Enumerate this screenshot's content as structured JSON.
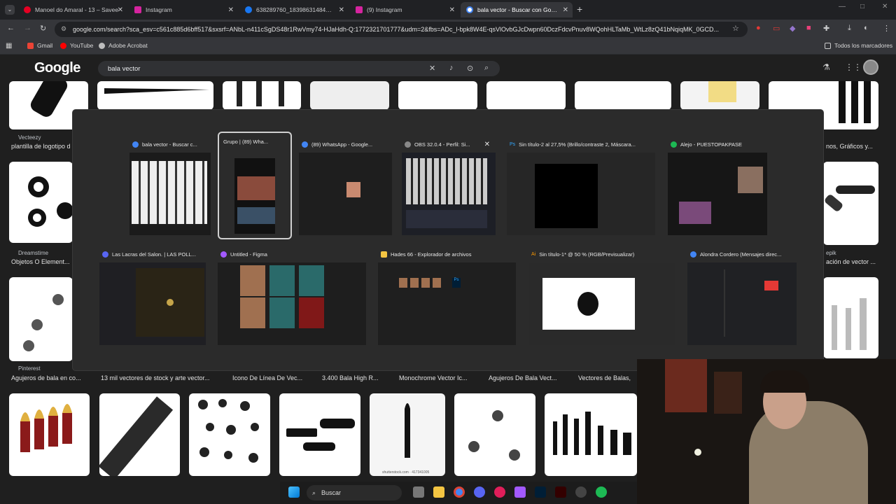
{
  "tabs": [
    {
      "title": "Manoel do Amaral - 13 – Savee",
      "color": "#e60023"
    },
    {
      "title": "Instagram",
      "color": "#d6249f"
    },
    {
      "title": "638289760_18398631484178590",
      "color": "#1877f2"
    },
    {
      "title": "(9) Instagram",
      "color": "#d6249f"
    },
    {
      "title": "bala vector - Buscar con Google",
      "color": "#ffffff"
    }
  ],
  "new_tab": "+",
  "url": "google.com/search?sca_esv=c561c885d6bff517&sxsrf=ANbL-n411cSgDS48r1RwVmy74-HJaHdh-Q:1772321701777&udm=2&fbs=ADc_l-bpk8W4E-qsVlOvbGJcDwpn60DczFdcvPnuv8WQohHLTaMb_WtLz8zQ41bNqiqMK_0GCD...",
  "bookmarks": [
    {
      "label": "Gmail",
      "color": "#ea4335"
    },
    {
      "label": "YouTube",
      "color": "#ff0000"
    },
    {
      "label": "Adobe Acrobat",
      "color": "#bdbdbd"
    }
  ],
  "all_bookmarks": "Todos los marcadores",
  "google": {
    "logo": "Google",
    "query": "bala vector"
  },
  "results": {
    "row1_src": "Vecteezy",
    "row1_cap": "plantilla de logotipo d",
    "row1_right": "nos, Gráficos y...",
    "row2_src": "Dreamstime",
    "row2_cap": "Objetos O Element...",
    "row2_right_src": "epik",
    "row2_right": "ación de vector ...",
    "row3_src": "Pinterest",
    "row3_caps": [
      "Agujeros de bala en co...",
      "13 mil vectores de stock y arte vector...",
      "Icono De Línea De Vec...",
      "3.400 Bala High R...",
      "Monochrome Vector Ic...",
      "Agujeros De Bala Vect...",
      "Vectores de Balas,"
    ],
    "shutter": "shutterstock.com · 417341005"
  },
  "switcher": {
    "row1": [
      {
        "title": "bala vector - Buscar c...",
        "icon": "#4285f4"
      },
      {
        "title": "Grupo | (89) Wha...",
        "icon": "#25d366"
      },
      {
        "title": "(89) WhatsApp - Google...",
        "icon": "#4285f4"
      },
      {
        "title": "OBS 32.0.4 - Perfil: Si...",
        "icon": "#888888",
        "close": "✕"
      },
      {
        "title": "Sin título-2 al 27,5% (Brillo/contraste 2, Máscara...",
        "icon": "#31a8ff",
        "badge": "Ps"
      },
      {
        "title": "Alejo - PUESTOPAKPASE",
        "icon": "#1db954"
      }
    ],
    "row2": [
      {
        "title": "Las Lacras del Salon. | LAS POLL...",
        "icon": "#5865f2"
      },
      {
        "title": "Untitled - Figma",
        "icon": "#a259ff"
      },
      {
        "title": "Hades 66 - Explorador de archivos",
        "icon": "#f4c542"
      },
      {
        "title": "Sin título-1* @ 50 % (RGB/Previsualizar)",
        "icon": "#ff3d00",
        "badge": "Ai"
      },
      {
        "title": "Alondra Cordero (Mensajes direc...",
        "icon": "#4285f4"
      }
    ],
    "ps_thumb_label": "Ps"
  },
  "taskbar": {
    "search": "Buscar"
  }
}
